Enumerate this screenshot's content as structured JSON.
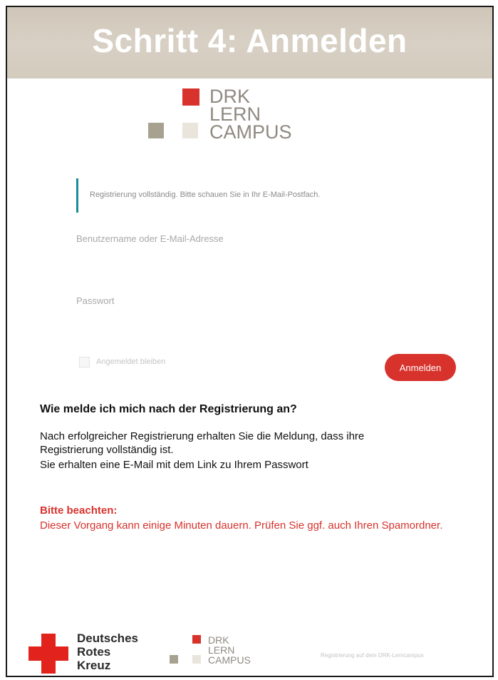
{
  "banner": {
    "title": "Schritt 4: Anmelden"
  },
  "logo": {
    "line1": "DRK",
    "line2": "LERN",
    "line3": "CAMPUS"
  },
  "colors": {
    "red": "#d7322c",
    "gray_square": "#a7a18f",
    "beige_square": "#e9e5dc",
    "accent_teal": "#1b8a9a",
    "banner_bg": "#d3cbbd"
  },
  "form": {
    "notice": "Registrierung vollständig. Bitte schauen Sie in Ihr E-Mail-Postfach.",
    "username_label": "Benutzername oder E-Mail-Adresse",
    "password_label": "Passwort",
    "remember_label": "Angemeldet bleiben",
    "login_button": "Anmelden"
  },
  "faq": {
    "heading": "Wie melde ich mich nach der Registrierung an?",
    "line1": "Nach erfolgreicher Registrierung erhalten Sie die Meldung, dass ihre",
    "line2": "Registrierung vollständig ist.",
    "line3": "Sie erhalten eine E-Mail mit dem Link zu Ihrem Passwort"
  },
  "note": {
    "title": "Bitte beachten:",
    "text": "Dieser Vorgang kann einige Minuten dauern. Prüfen Sie ggf. auch Ihren Spamordner."
  },
  "footer": {
    "drk_line1": "Deutsches",
    "drk_line2": "Rotes",
    "drk_line3": "Kreuz",
    "caption": "Registrierung auf dem DRK-Lerncampus"
  }
}
